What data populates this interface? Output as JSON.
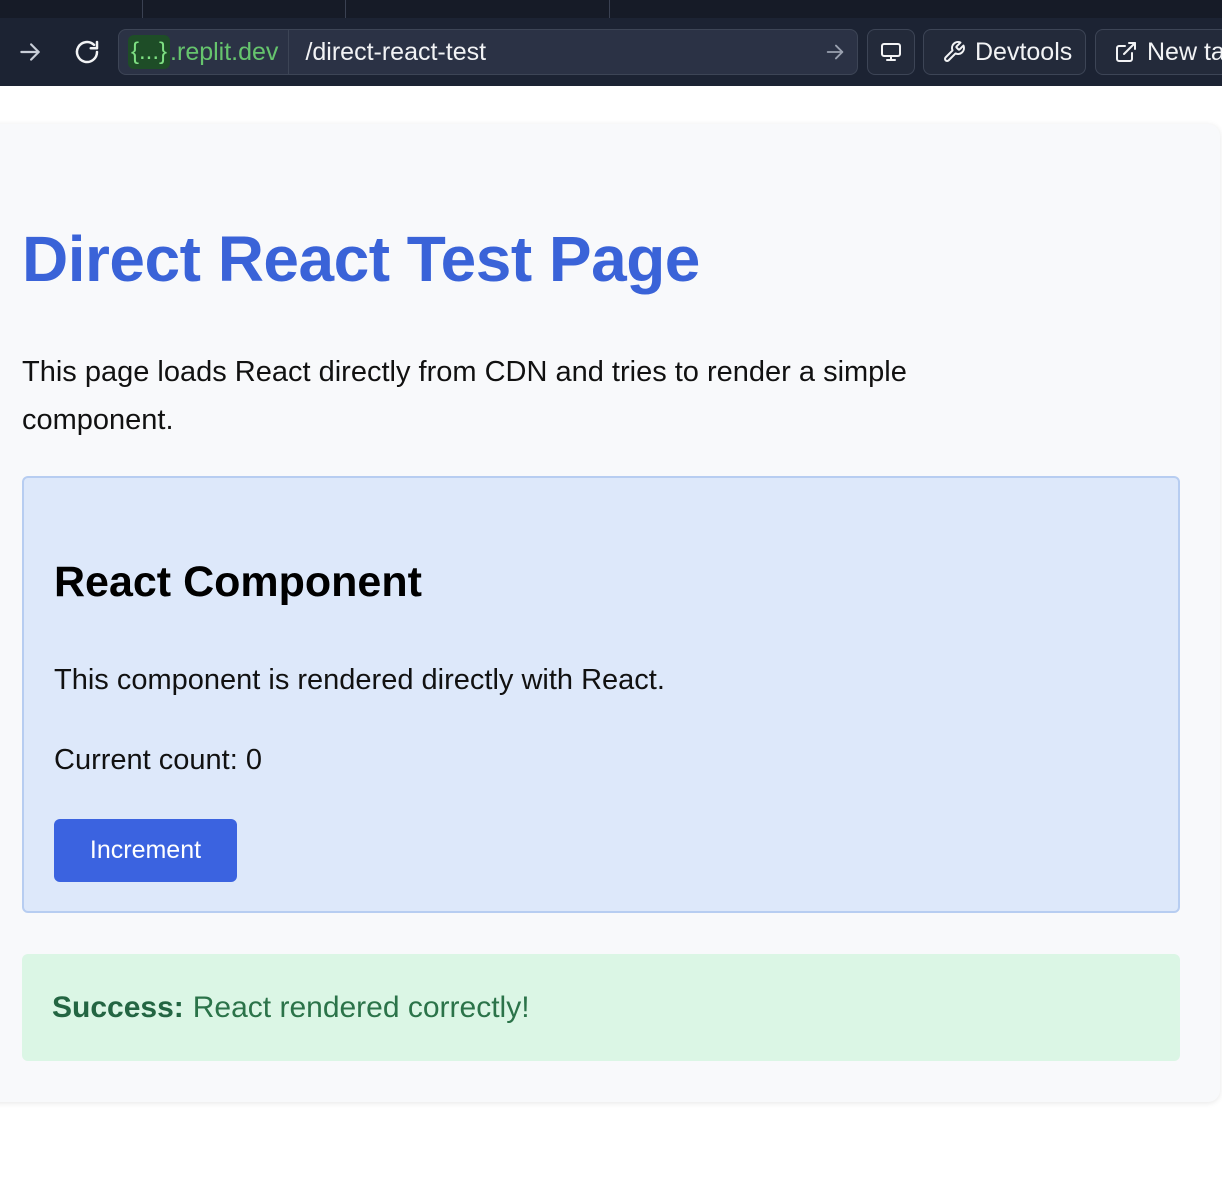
{
  "browser": {
    "address": {
      "domain_badge": "{...}",
      "domain_suffix": ".replit.dev",
      "path": "/direct-react-test"
    },
    "toolbar": {
      "devtools_label": "Devtools",
      "new_tab_label": "New tab"
    },
    "icons": {
      "forward": "arrow-right-icon",
      "reload": "reload-icon",
      "go": "arrow-right-icon",
      "device": "monitor-icon",
      "devtools": "wrench-icon",
      "new_tab": "external-link-icon"
    },
    "colors": {
      "chrome_bg": "#1c2333",
      "domain_green": "#66c46d"
    }
  },
  "page": {
    "title": "Direct React Test Page",
    "intro": "This page loads React directly from CDN and tries to render a simple component.",
    "component": {
      "title": "React Component",
      "description": "This component is rendered directly with React.",
      "count_label": "Current count: 0",
      "increment_label": "Increment"
    },
    "success": {
      "label": "Success:",
      "message": "React rendered correctly!"
    },
    "colors": {
      "title": "#3a63d8",
      "button": "#3b63e0",
      "component_bg": "#dde8fa",
      "success_bg": "#dbf6e5",
      "success_text": "#2b7349"
    }
  }
}
